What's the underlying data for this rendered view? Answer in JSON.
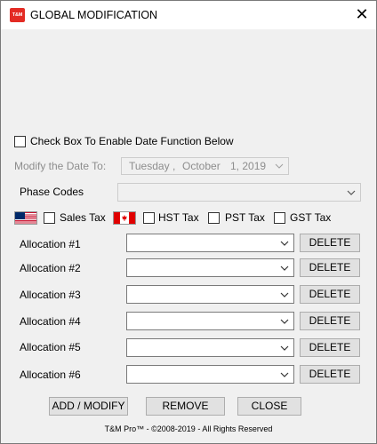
{
  "window": {
    "title": "GLOBAL MODIFICATION",
    "icon_text": "T&M",
    "close_symbol": "✕"
  },
  "date_section": {
    "enable_checkbox_label": "Check Box To Enable Date Function Below",
    "enable_checked": false,
    "modify_label": "Modify the Date To:",
    "date_weekday": "Tuesday",
    "date_sep": ",",
    "date_month": "October",
    "date_day_year": "1, 2019"
  },
  "phase_codes": {
    "label": "Phase Codes",
    "value": ""
  },
  "tax": {
    "sales_tax_label": "Sales Tax",
    "hst_tax_label": "HST Tax",
    "pst_tax_label": "PST Tax",
    "gst_tax_label": "GST Tax"
  },
  "allocations": [
    {
      "label": "Allocation #1",
      "value": "",
      "delete_label": "DELETE"
    },
    {
      "label": "Allocation #2",
      "value": "",
      "delete_label": "DELETE"
    },
    {
      "label": "Allocation #3",
      "value": "",
      "delete_label": "DELETE"
    },
    {
      "label": "Allocation #4",
      "value": "",
      "delete_label": "DELETE"
    },
    {
      "label": "Allocation #5",
      "value": "",
      "delete_label": "DELETE"
    },
    {
      "label": "Allocation #6",
      "value": "",
      "delete_label": "DELETE"
    }
  ],
  "actions": {
    "add_modify_label": "ADD / MODIFY",
    "remove_label": "REMOVE",
    "close_label": "CLOSE"
  },
  "footer": {
    "text": "T&M Pro™ - ©2008-2019 - All Rights Reserved"
  },
  "icons": {
    "dropdown": "chevron-down-icon",
    "flag_us": "us-flag-icon",
    "flag_ca": "canada-flag-icon"
  },
  "colors": {
    "window_bg": "#f0f0f0",
    "titlebar_bg": "#ffffff",
    "icon_red": "#e32b24",
    "disabled_text": "#8d8d8d"
  }
}
